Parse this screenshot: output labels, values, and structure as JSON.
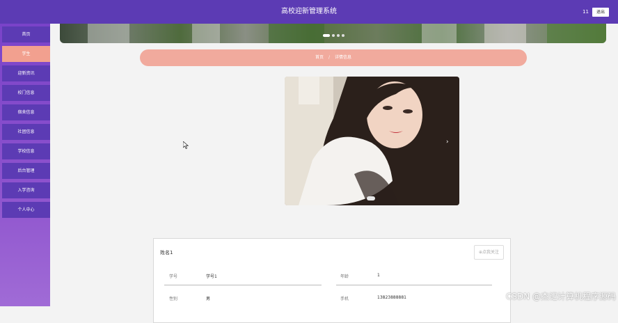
{
  "header": {
    "title": "高校迎新管理系统",
    "user": "11",
    "logout_label": "退出"
  },
  "sidebar": {
    "items": [
      {
        "label": "首页"
      },
      {
        "label": "学生"
      },
      {
        "label": "迎新资讯"
      },
      {
        "label": "校门信息"
      },
      {
        "label": "宿舍信息"
      },
      {
        "label": "社团信息"
      },
      {
        "label": "学校信息"
      },
      {
        "label": "后台管理"
      },
      {
        "label": "入学咨询"
      },
      {
        "label": "个人中心"
      }
    ],
    "active_index": 1
  },
  "breadcrumb": {
    "home": "首页",
    "separator": "/",
    "current": "详情信息"
  },
  "carousel": {
    "slide_count": 4,
    "active_slide": 1,
    "next_glyph": "›"
  },
  "detail": {
    "name": "姓名1",
    "follow_label": "⊕点我关注",
    "fields": [
      {
        "label": "学号",
        "value": "学号1"
      },
      {
        "label": "年龄",
        "value": "1"
      },
      {
        "label": "性别",
        "value": "男"
      },
      {
        "label": "手机",
        "value": "13823888881"
      }
    ]
  },
  "watermark": "CSDN @杰记计算机程序源码",
  "colors": {
    "primary": "#5c3bb4",
    "accent": "#f1aa9d",
    "sidebar_gradient_end": "#a06bd6"
  }
}
